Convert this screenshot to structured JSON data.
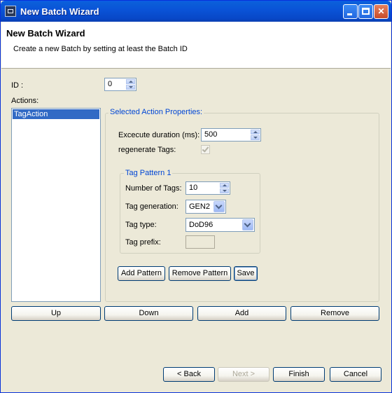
{
  "window": {
    "title": "New Batch Wizard"
  },
  "header": {
    "title": "New Batch Wizard",
    "description": "Create a new Batch by setting at least the Batch ID"
  },
  "form": {
    "id_label": "ID :",
    "id_value": "0",
    "actions_label": "Actions:",
    "actions": [
      "TagAction"
    ]
  },
  "properties": {
    "legend": "Selected Action Properties:",
    "duration_label": "Excecute duration (ms):",
    "duration_value": "500",
    "regenerate_label": "regenerate Tags:",
    "regenerate_checked": true
  },
  "pattern": {
    "legend": "Tag Pattern 1",
    "num_tags_label": "Number of Tags:",
    "num_tags_value": "10",
    "generation_label": "Tag generation:",
    "generation_value": "GEN2",
    "type_label": "Tag type:",
    "type_value": "DoD96",
    "prefix_label": "Tag prefix:",
    "prefix_value": ""
  },
  "pattern_buttons": {
    "add": "Add Pattern",
    "remove": "Remove Pattern",
    "save": "Save"
  },
  "list_buttons": {
    "up": "Up",
    "down": "Down",
    "add": "Add",
    "remove": "Remove"
  },
  "nav": {
    "back": "< Back",
    "next": "Next >",
    "finish": "Finish",
    "cancel": "Cancel"
  }
}
